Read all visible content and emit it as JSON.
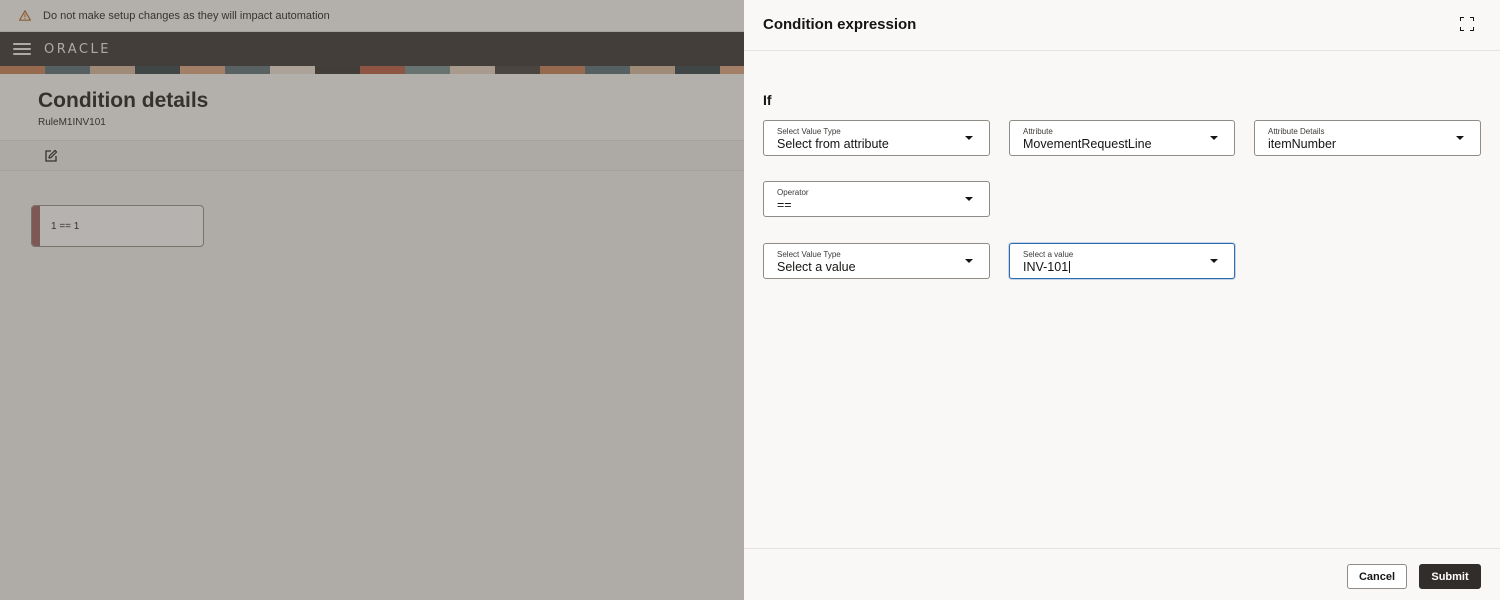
{
  "banner": {
    "message": "Do not make setup changes as they will impact automation",
    "icon": "warning-icon"
  },
  "header": {
    "logo": "ORACLE",
    "menu_icon": "hamburger-menu-icon"
  },
  "page": {
    "title": "Condition details",
    "subtitle": "RuleM1INV101"
  },
  "toolbar": {
    "edit_icon": "edit-icon"
  },
  "canvas": {
    "condition_card_text": "1 == 1"
  },
  "drawer": {
    "title": "Condition expression",
    "expand_icon": "expand-icon",
    "if_label": "If",
    "fields": {
      "left_value_type": {
        "label": "Select Value Type",
        "value": "Select from attribute"
      },
      "attribute": {
        "label": "Attribute",
        "value": "MovementRequestLine"
      },
      "attribute_details": {
        "label": "Attribute Details",
        "value": "itemNumber"
      },
      "operator": {
        "label": "Operator",
        "value": "=="
      },
      "right_value_type": {
        "label": "Select Value Type",
        "value": "Select a value"
      },
      "right_value": {
        "label": "Select a value",
        "value": "INV-101"
      }
    },
    "cancel_label": "Cancel",
    "submit_label": "Submit"
  },
  "colors": {
    "header_bg": "#312d2a",
    "warning_icon": "#b5651d",
    "active_field_border": "#2b6cb0",
    "card_accent": "#9a5c5c"
  }
}
